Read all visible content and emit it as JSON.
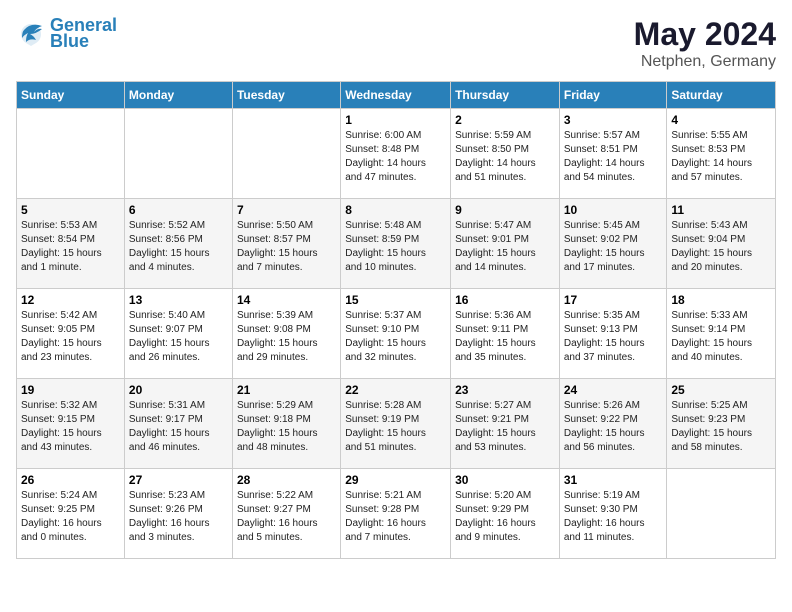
{
  "header": {
    "logo_line1": "General",
    "logo_line2": "Blue",
    "month": "May 2024",
    "location": "Netphen, Germany"
  },
  "weekdays": [
    "Sunday",
    "Monday",
    "Tuesday",
    "Wednesday",
    "Thursday",
    "Friday",
    "Saturday"
  ],
  "weeks": [
    [
      {
        "day": "",
        "info": ""
      },
      {
        "day": "",
        "info": ""
      },
      {
        "day": "",
        "info": ""
      },
      {
        "day": "1",
        "info": "Sunrise: 6:00 AM\nSunset: 8:48 PM\nDaylight: 14 hours\nand 47 minutes."
      },
      {
        "day": "2",
        "info": "Sunrise: 5:59 AM\nSunset: 8:50 PM\nDaylight: 14 hours\nand 51 minutes."
      },
      {
        "day": "3",
        "info": "Sunrise: 5:57 AM\nSunset: 8:51 PM\nDaylight: 14 hours\nand 54 minutes."
      },
      {
        "day": "4",
        "info": "Sunrise: 5:55 AM\nSunset: 8:53 PM\nDaylight: 14 hours\nand 57 minutes."
      }
    ],
    [
      {
        "day": "5",
        "info": "Sunrise: 5:53 AM\nSunset: 8:54 PM\nDaylight: 15 hours\nand 1 minute."
      },
      {
        "day": "6",
        "info": "Sunrise: 5:52 AM\nSunset: 8:56 PM\nDaylight: 15 hours\nand 4 minutes."
      },
      {
        "day": "7",
        "info": "Sunrise: 5:50 AM\nSunset: 8:57 PM\nDaylight: 15 hours\nand 7 minutes."
      },
      {
        "day": "8",
        "info": "Sunrise: 5:48 AM\nSunset: 8:59 PM\nDaylight: 15 hours\nand 10 minutes."
      },
      {
        "day": "9",
        "info": "Sunrise: 5:47 AM\nSunset: 9:01 PM\nDaylight: 15 hours\nand 14 minutes."
      },
      {
        "day": "10",
        "info": "Sunrise: 5:45 AM\nSunset: 9:02 PM\nDaylight: 15 hours\nand 17 minutes."
      },
      {
        "day": "11",
        "info": "Sunrise: 5:43 AM\nSunset: 9:04 PM\nDaylight: 15 hours\nand 20 minutes."
      }
    ],
    [
      {
        "day": "12",
        "info": "Sunrise: 5:42 AM\nSunset: 9:05 PM\nDaylight: 15 hours\nand 23 minutes."
      },
      {
        "day": "13",
        "info": "Sunrise: 5:40 AM\nSunset: 9:07 PM\nDaylight: 15 hours\nand 26 minutes."
      },
      {
        "day": "14",
        "info": "Sunrise: 5:39 AM\nSunset: 9:08 PM\nDaylight: 15 hours\nand 29 minutes."
      },
      {
        "day": "15",
        "info": "Sunrise: 5:37 AM\nSunset: 9:10 PM\nDaylight: 15 hours\nand 32 minutes."
      },
      {
        "day": "16",
        "info": "Sunrise: 5:36 AM\nSunset: 9:11 PM\nDaylight: 15 hours\nand 35 minutes."
      },
      {
        "day": "17",
        "info": "Sunrise: 5:35 AM\nSunset: 9:13 PM\nDaylight: 15 hours\nand 37 minutes."
      },
      {
        "day": "18",
        "info": "Sunrise: 5:33 AM\nSunset: 9:14 PM\nDaylight: 15 hours\nand 40 minutes."
      }
    ],
    [
      {
        "day": "19",
        "info": "Sunrise: 5:32 AM\nSunset: 9:15 PM\nDaylight: 15 hours\nand 43 minutes."
      },
      {
        "day": "20",
        "info": "Sunrise: 5:31 AM\nSunset: 9:17 PM\nDaylight: 15 hours\nand 46 minutes."
      },
      {
        "day": "21",
        "info": "Sunrise: 5:29 AM\nSunset: 9:18 PM\nDaylight: 15 hours\nand 48 minutes."
      },
      {
        "day": "22",
        "info": "Sunrise: 5:28 AM\nSunset: 9:19 PM\nDaylight: 15 hours\nand 51 minutes."
      },
      {
        "day": "23",
        "info": "Sunrise: 5:27 AM\nSunset: 9:21 PM\nDaylight: 15 hours\nand 53 minutes."
      },
      {
        "day": "24",
        "info": "Sunrise: 5:26 AM\nSunset: 9:22 PM\nDaylight: 15 hours\nand 56 minutes."
      },
      {
        "day": "25",
        "info": "Sunrise: 5:25 AM\nSunset: 9:23 PM\nDaylight: 15 hours\nand 58 minutes."
      }
    ],
    [
      {
        "day": "26",
        "info": "Sunrise: 5:24 AM\nSunset: 9:25 PM\nDaylight: 16 hours\nand 0 minutes."
      },
      {
        "day": "27",
        "info": "Sunrise: 5:23 AM\nSunset: 9:26 PM\nDaylight: 16 hours\nand 3 minutes."
      },
      {
        "day": "28",
        "info": "Sunrise: 5:22 AM\nSunset: 9:27 PM\nDaylight: 16 hours\nand 5 minutes."
      },
      {
        "day": "29",
        "info": "Sunrise: 5:21 AM\nSunset: 9:28 PM\nDaylight: 16 hours\nand 7 minutes."
      },
      {
        "day": "30",
        "info": "Sunrise: 5:20 AM\nSunset: 9:29 PM\nDaylight: 16 hours\nand 9 minutes."
      },
      {
        "day": "31",
        "info": "Sunrise: 5:19 AM\nSunset: 9:30 PM\nDaylight: 16 hours\nand 11 minutes."
      },
      {
        "day": "",
        "info": ""
      }
    ]
  ]
}
